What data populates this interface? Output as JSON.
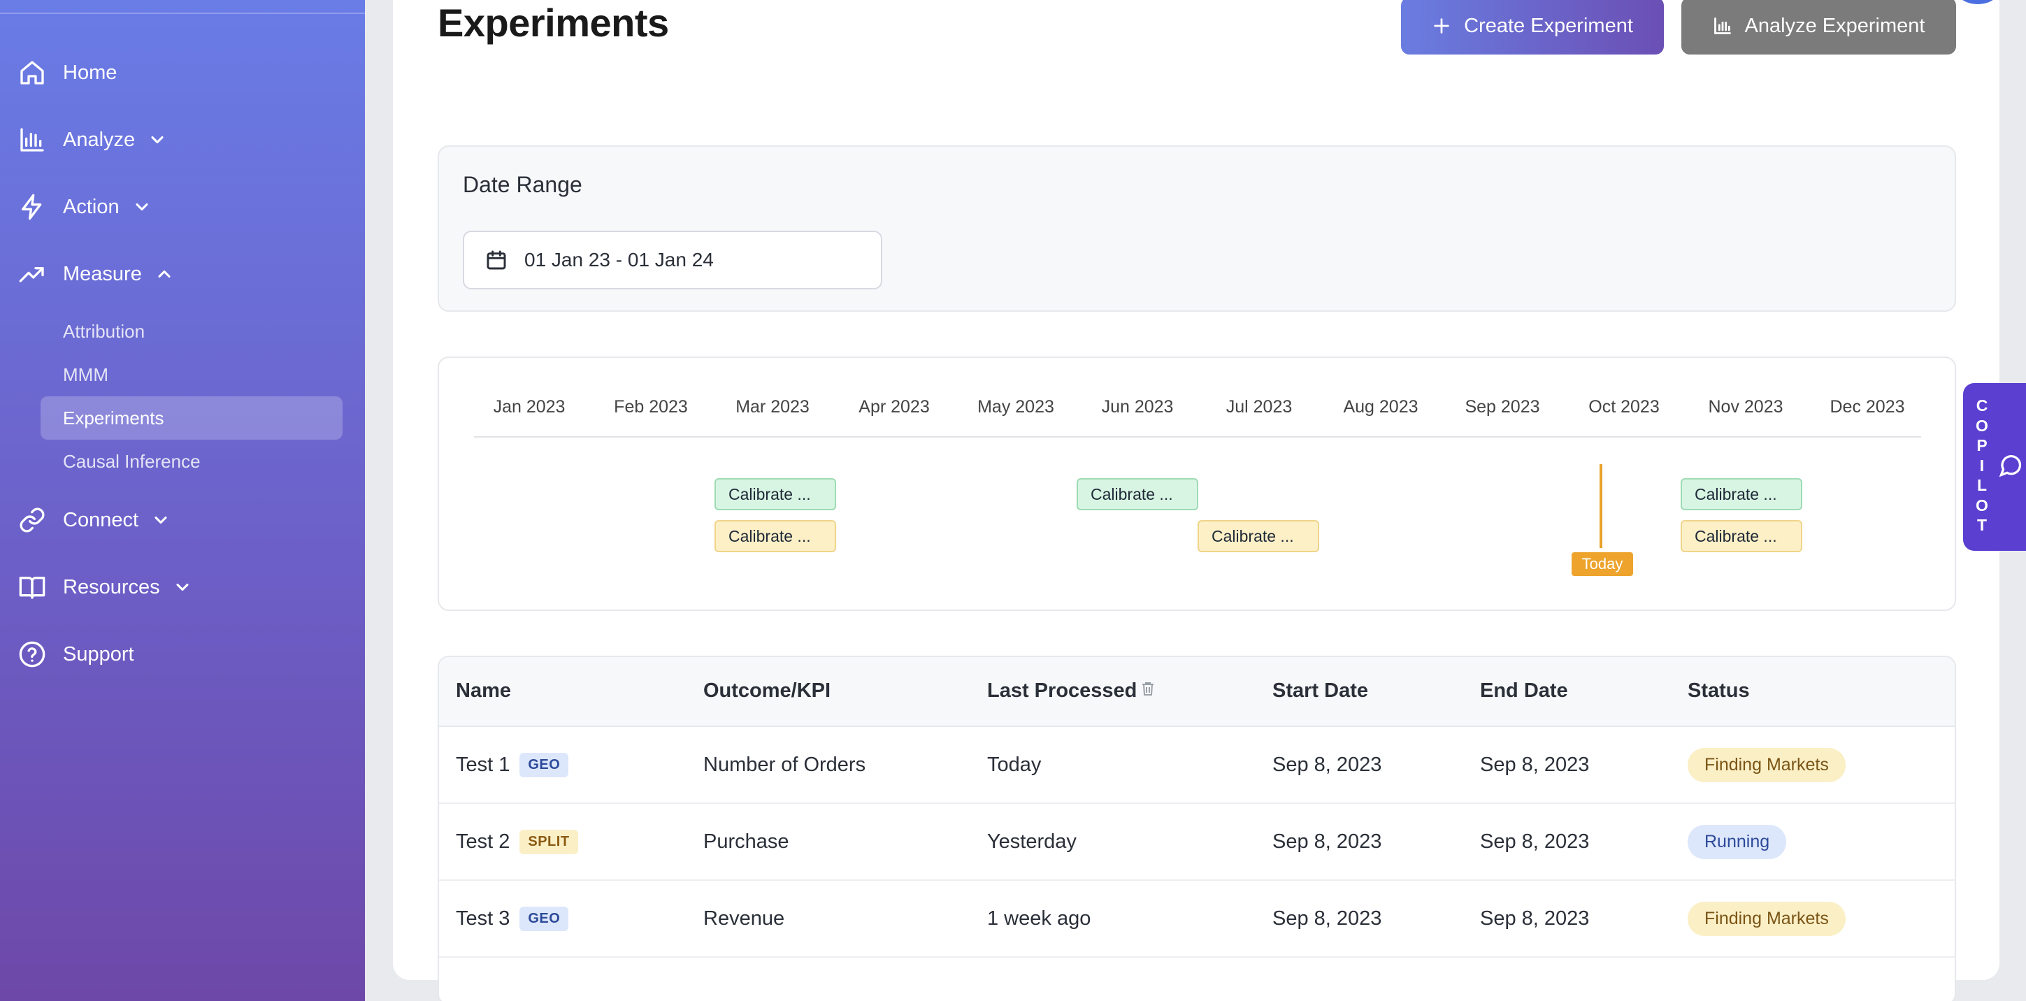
{
  "sidebar": {
    "items": [
      {
        "label": "Home",
        "icon": "home-icon"
      },
      {
        "label": "Analyze",
        "icon": "bar-chart-icon"
      },
      {
        "label": "Action",
        "icon": "lightning-icon"
      },
      {
        "label": "Measure",
        "icon": "trending-up-icon"
      },
      {
        "label": "Connect",
        "icon": "link-icon"
      },
      {
        "label": "Resources",
        "icon": "book-icon"
      },
      {
        "label": "Support",
        "icon": "help-circle-icon"
      }
    ],
    "measure_sub": [
      "Attribution",
      "MMM",
      "Experiments",
      "Causal Inference"
    ],
    "active_sub": "Experiments"
  },
  "header": {
    "title": "Experiments",
    "create_label": "Create Experiment",
    "analyze_label": "Analyze Experiment"
  },
  "date_range": {
    "title": "Date Range",
    "value": "01 Jan 23 - 01 Jan 24"
  },
  "timeline": {
    "months": [
      "Jan 2023",
      "Feb 2023",
      "Mar 2023",
      "Apr 2023",
      "May 2023",
      "Jun 2023",
      "Jul 2023",
      "Aug 2023",
      "Sep 2023",
      "Oct 2023",
      "Nov 2023",
      "Dec 2023"
    ],
    "bars": [
      {
        "label": "Calibrate ...",
        "color": "green"
      },
      {
        "label": "Calibrate ...",
        "color": "yellow"
      },
      {
        "label": "Calibrate ...",
        "color": "green"
      },
      {
        "label": "Calibrate ...",
        "color": "yellow"
      },
      {
        "label": "Calibrate ...",
        "color": "green"
      },
      {
        "label": "Calibrate ...",
        "color": "yellow"
      }
    ],
    "today_label": "Today"
  },
  "table": {
    "headers": [
      "Name",
      "Outcome/KPI",
      "Last Processed",
      "Start Date",
      "End Date",
      "Status"
    ],
    "rows": [
      {
        "name": "Test 1",
        "tag": "GEO",
        "kpi": "Number of Orders",
        "last": "Today",
        "start": "Sep 8, 2023",
        "end": "Sep 8, 2023",
        "status": "Finding Markets"
      },
      {
        "name": "Test 2",
        "tag": "SPLIT",
        "kpi": "Purchase",
        "last": "Yesterday",
        "start": "Sep 8, 2023",
        "end": "Sep 8, 2023",
        "status": "Running"
      },
      {
        "name": "Test 3",
        "tag": "GEO",
        "kpi": "Revenue",
        "last": "1 week ago",
        "start": "Sep 8, 2023",
        "end": "Sep 8, 2023",
        "status": "Finding Markets"
      }
    ]
  },
  "copilot": {
    "label": "COPILOT"
  },
  "colors": {
    "accent": "#6a7de0",
    "today": "#eda32c"
  }
}
